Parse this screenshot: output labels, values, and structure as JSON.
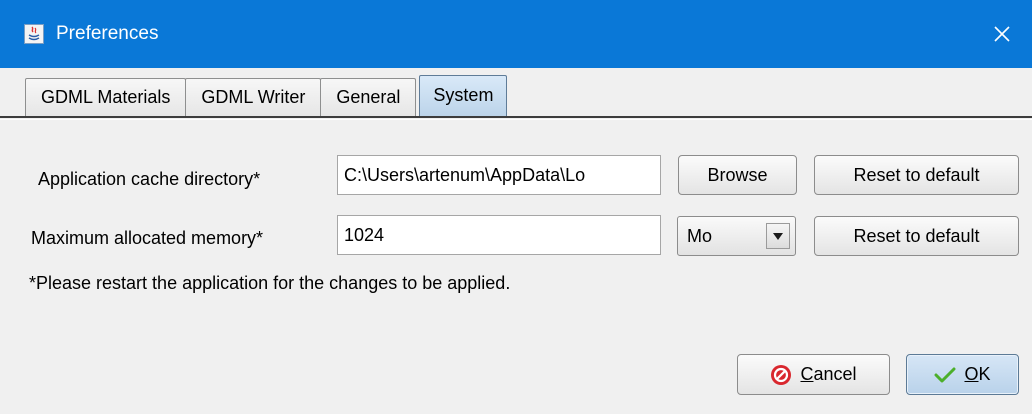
{
  "window": {
    "title": "Preferences",
    "titlebar_color": "#0a78d7",
    "app_icon": "java-icon",
    "close_icon": "close-icon"
  },
  "tabs": [
    {
      "label": "GDML Materials",
      "selected": false
    },
    {
      "label": "GDML Writer",
      "selected": false
    },
    {
      "label": "General",
      "selected": false
    },
    {
      "label": "System",
      "selected": true
    }
  ],
  "form": {
    "cache_dir": {
      "label": "Application cache directory*",
      "value": "C:\\Users\\artenum\\AppData\\Lo",
      "browse_label": "Browse",
      "reset_label": "Reset to default"
    },
    "memory": {
      "label": "Maximum allocated memory*",
      "value": "1024",
      "unit_selected": "Mo",
      "unit_icon": "dropdown-arrow-icon",
      "reset_label": "Reset to default"
    },
    "note": "*Please restart the application for the changes to be applied."
  },
  "buttons": {
    "cancel_mnemonic": "C",
    "cancel_rest": "ancel",
    "cancel_icon": "cancel-icon",
    "ok_mnemonic": "O",
    "ok_rest": "K",
    "ok_icon": "checkmark-icon",
    "cancel_icon_color": "#d9272e",
    "ok_icon_color": "#4caf2a"
  }
}
